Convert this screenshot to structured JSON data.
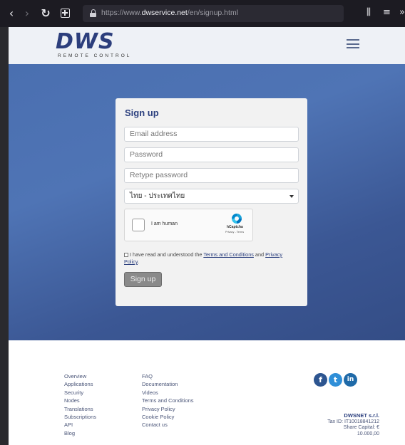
{
  "browser": {
    "url_prefix": "https://www.",
    "url_host": "dwservice.net",
    "url_path": "/en/signup.html"
  },
  "header": {
    "logo_word": "DWS",
    "logo_tagline": "REMOTE CONTROL"
  },
  "signup": {
    "title": "Sign up",
    "email_placeholder": "Email address",
    "password_placeholder": "Password",
    "retype_placeholder": "Retype password",
    "language_selected": "ไทย - ประเทศไทย",
    "captcha_label": "I am human",
    "captcha_brand": "hCaptcha",
    "captcha_links": "Privacy - Terms",
    "terms_prefix": "I have read and understood the ",
    "terms_link": "Terms and Conditions",
    "terms_mid": " and ",
    "privacy_link": "Privacy Policy",
    "terms_suffix": ".",
    "button_label": "Sign up"
  },
  "footer": {
    "col1": [
      "Overview",
      "Applications",
      "Security",
      "Nodes",
      "Translations",
      "Subscriptions",
      "API",
      "Blog"
    ],
    "col2": [
      "FAQ",
      "Documentation",
      "Videos",
      "Terms and Conditions",
      "Privacy Policy",
      "Cookie Policy",
      "Contact us"
    ],
    "social": [
      "facebook-icon",
      "twitter-icon",
      "linkedin-icon"
    ],
    "company_name": "DWSNET s.r.l.",
    "tax_id": "Tax ID: IT10018841212",
    "share_capital": "Share Capital: €",
    "share_amount": "10.000,00"
  },
  "colors": {
    "brand": "#2b3f7e",
    "hero_top": "#4f74b5",
    "hero_bottom": "#344d86"
  }
}
